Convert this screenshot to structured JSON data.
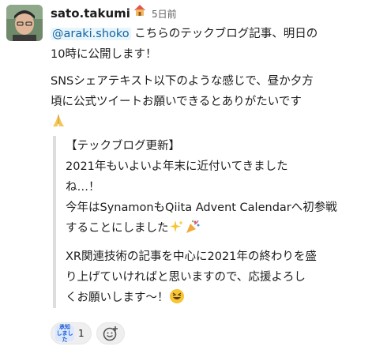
{
  "message": {
    "username": "sato.takumi",
    "status_emoji": "house-emoji",
    "timestamp": "5日前",
    "mention": "@araki.shoko",
    "line1_rest": " こちらのテックブログ記事、明日の",
    "line2": "10時に公開します！",
    "para2_line1": "SNSシェアテキスト以下のような感じで、昼か夕方",
    "para2_line2": "頃に公式ツイートお願いできるとありがたいです",
    "para2_emoji": "folded-hands-emoji",
    "quote": {
      "title": "【テックブログ更新】",
      "l1": "2021年もいよいよ年末に近付いてきました",
      "l2": "ね…！",
      "l3": "今年はSynamonもQiita Advent Calendarへ初参戦",
      "l4": "することにしました",
      "l4_emojis": [
        "sparkles-emoji",
        "party-popper-emoji"
      ],
      "l5": "XR関連技術の記事を中心に2021年の終わりを盛",
      "l6": "り上げていければと思いますので、応援よろし",
      "l7": "くお願いします〜！",
      "l7_emoji": "grinning-squinting-emoji"
    }
  },
  "reactions": [
    {
      "emoji_text_top": "承知",
      "emoji_text_bottom": "しました",
      "count": "1"
    }
  ],
  "colors": {
    "mention": "#1264a3",
    "mention_bg": "#e8f5fa",
    "quote_bar": "#dddddd"
  }
}
